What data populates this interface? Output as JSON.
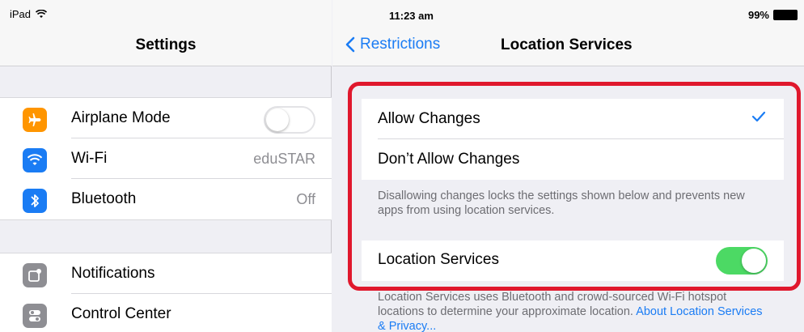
{
  "status": {
    "device": "iPad",
    "time": "11:23 am",
    "battery": "99%"
  },
  "left": {
    "title": "Settings",
    "group1": [
      {
        "label": "Airplane Mode",
        "value": "",
        "icon": "airplane-icon",
        "color": "#ff9500"
      },
      {
        "label": "Wi-Fi",
        "value": "eduSTAR",
        "icon": "wifi-icon",
        "color": "#1a7cf4"
      },
      {
        "label": "Bluetooth",
        "value": "Off",
        "icon": "bluetooth-icon",
        "color": "#1a7cf4"
      }
    ],
    "group2": [
      {
        "label": "Notifications",
        "icon": "notifications-icon",
        "color": "#8e8e93"
      },
      {
        "label": "Control Center",
        "icon": "control-center-icon",
        "color": "#8e8e93"
      }
    ]
  },
  "right": {
    "back_label": "Restrictions",
    "title": "Location Services",
    "options": [
      "Allow Changes",
      "Don’t Allow Changes"
    ],
    "selected_option": "Allow Changes",
    "note1": "Disallowing changes locks the settings shown below and prevents new apps from using location services.",
    "location_services_label": "Location Services",
    "location_services_on": true,
    "note2": "Location Services uses Bluetooth and crowd-sourced Wi-Fi hotspot locations to determine your approximate location.",
    "link": "About Location Services & Privacy..."
  },
  "colors": {
    "accent": "#1a7cf4",
    "toggle_on": "#4cd964",
    "highlight": "#e0182d"
  }
}
